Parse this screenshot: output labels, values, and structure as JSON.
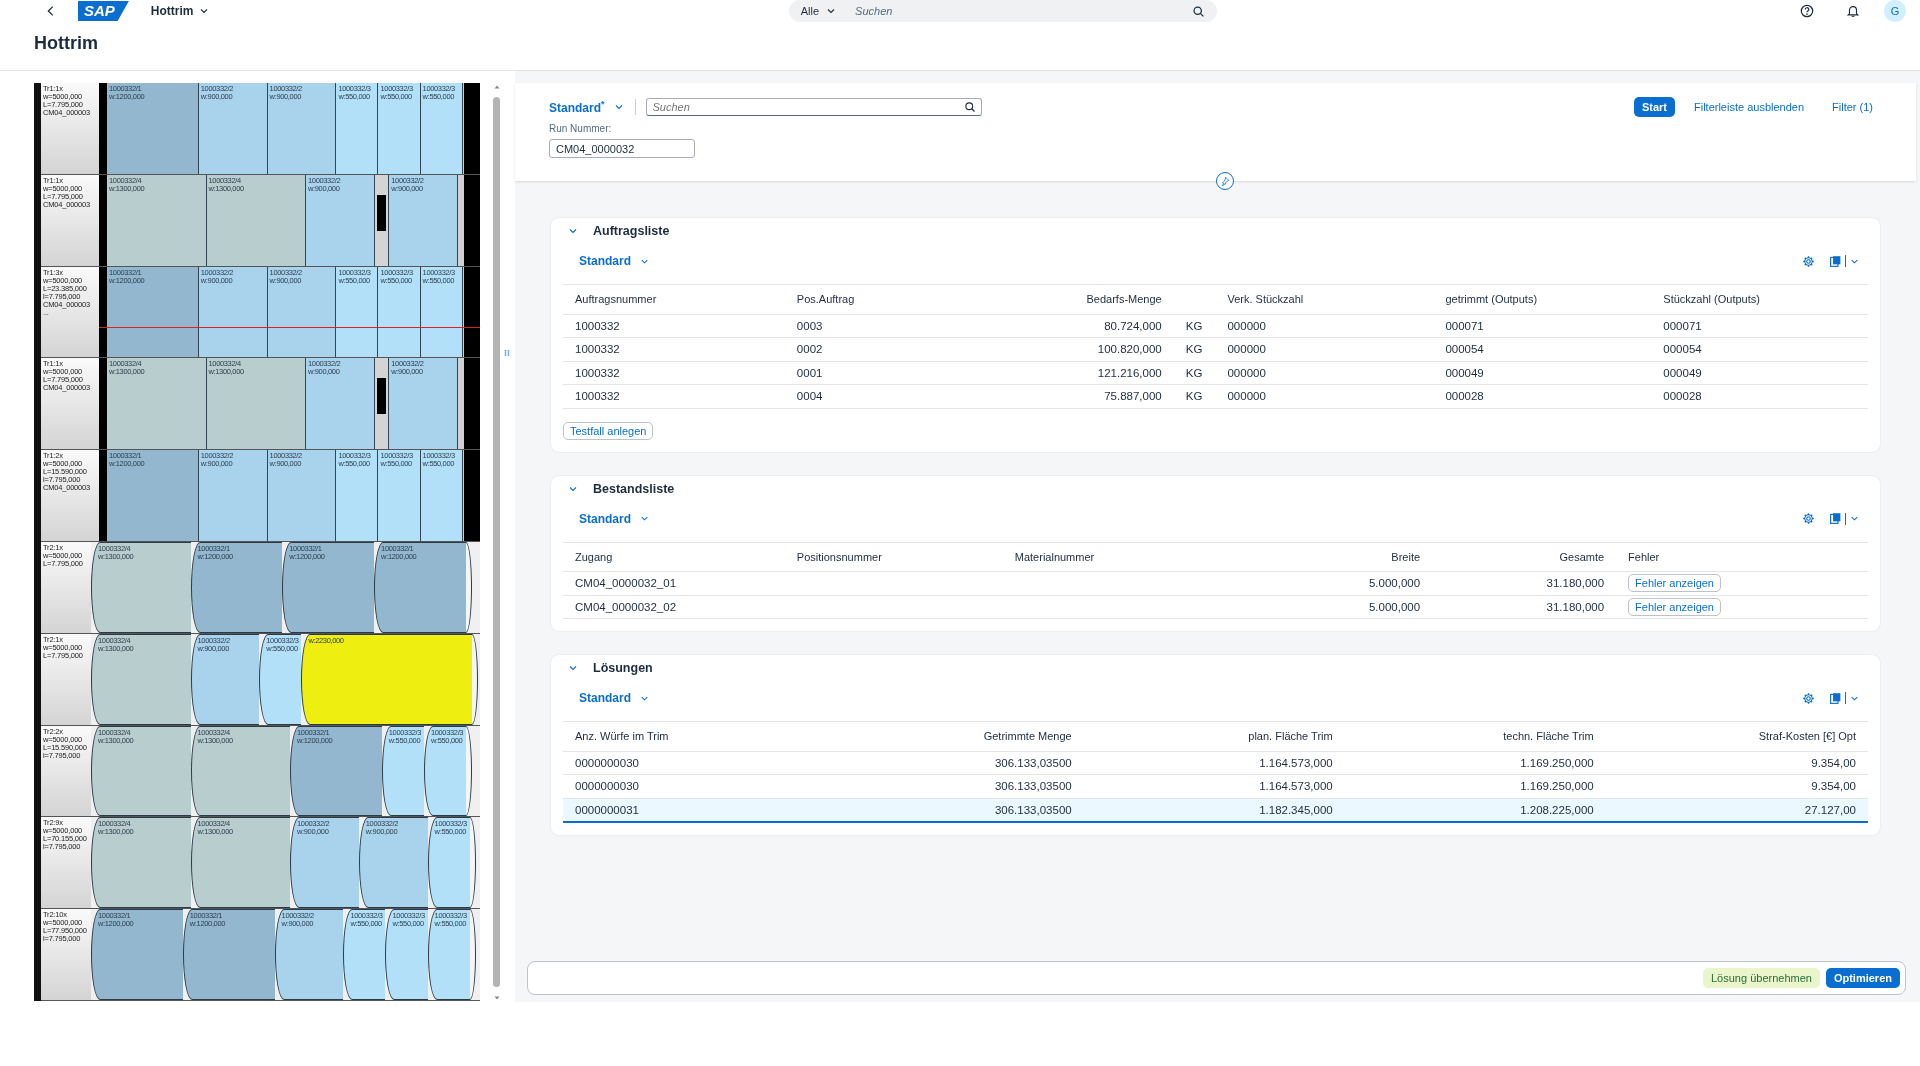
{
  "shell": {
    "logo": "SAP",
    "app_title": "Hottrim",
    "search_scope": "Alle",
    "search_placeholder": "Suchen",
    "avatar": "G"
  },
  "page_title": "Hottrim",
  "diagram": {
    "rows": [
      {
        "kind": "flat",
        "marked": false,
        "label": [
          "Tr1:1x",
          "w=5000,000",
          "L=7.795,000",
          "CM04_000003"
        ],
        "segments": [
          {
            "kind": "p1",
            "id": "1000332/1",
            "width": "w:1200,000"
          },
          {
            "kind": "p2",
            "id": "1000332/2",
            "width": "w:900,000"
          },
          {
            "kind": "p2",
            "id": "1000332/2",
            "width": "w:900,000"
          },
          {
            "kind": "p3",
            "id": "1000332/3",
            "width": "w:550,000"
          },
          {
            "kind": "p3",
            "id": "1000332/3",
            "width": "w:550,000"
          },
          {
            "kind": "p3",
            "id": "1000332/3",
            "width": "w:550,000"
          }
        ]
      },
      {
        "kind": "flat",
        "marked": false,
        "label": [
          "Tr1:1x",
          "w=5000,000",
          "L=7.795,000",
          "CM04_000003"
        ],
        "segments": [
          {
            "kind": "p4",
            "id": "1000332/4",
            "width": "w:1300,000"
          },
          {
            "kind": "p4",
            "id": "1000332/4",
            "width": "w:1300,000"
          },
          {
            "kind": "p2",
            "id": "1000332/2",
            "width": "w:900,000"
          },
          {
            "kind": "gap"
          },
          {
            "kind": "p2",
            "id": "1000332/2",
            "width": "w:900,000"
          }
        ]
      },
      {
        "kind": "flat",
        "marked": true,
        "label": [
          "Tr1:3x",
          "w=5000,000",
          "L=23.385,000",
          "l=7.795,000",
          "CM04_000003",
          "..."
        ],
        "segments": [
          {
            "kind": "p1",
            "id": "1000332/1",
            "width": "w:1200,000"
          },
          {
            "kind": "p2",
            "id": "1000332/2",
            "width": "w:900,000"
          },
          {
            "kind": "p2",
            "id": "1000332/2",
            "width": "w:900,000"
          },
          {
            "kind": "p3",
            "id": "1000332/3",
            "width": "w:550,000"
          },
          {
            "kind": "p3",
            "id": "1000332/3",
            "width": "w:550,000"
          },
          {
            "kind": "p3",
            "id": "1000332/3",
            "width": "w:550,000"
          }
        ]
      },
      {
        "kind": "flat",
        "marked": false,
        "label": [
          "Tr1:1x",
          "w=5000,000",
          "L=7.795,000",
          "CM04_000003"
        ],
        "segments": [
          {
            "kind": "p4",
            "id": "1000332/4",
            "width": "w:1300,000"
          },
          {
            "kind": "p4",
            "id": "1000332/4",
            "width": "w:1300,000"
          },
          {
            "kind": "p2",
            "id": "1000332/2",
            "width": "w:900,000"
          },
          {
            "kind": "gap"
          },
          {
            "kind": "p2",
            "id": "1000332/2",
            "width": "w:900,000"
          }
        ]
      },
      {
        "kind": "flat",
        "marked": false,
        "label": [
          "Tr1:2x",
          "w=5000,000",
          "L=15.590,000",
          "l=7.795,000",
          "CM04_000003"
        ],
        "segments": [
          {
            "kind": "p1",
            "id": "1000332/1",
            "width": "w:1200,000"
          },
          {
            "kind": "p2",
            "id": "1000332/2",
            "width": "w:900,000"
          },
          {
            "kind": "p2",
            "id": "1000332/2",
            "width": "w:900,000"
          },
          {
            "kind": "p3",
            "id": "1000332/3",
            "width": "w:550,000"
          },
          {
            "kind": "p3",
            "id": "1000332/3",
            "width": "w:550,000"
          },
          {
            "kind": "p3",
            "id": "1000332/3",
            "width": "w:550,000"
          }
        ]
      },
      {
        "kind": "roll",
        "marked": false,
        "label": [
          "Tr2:1x",
          "w=5000,000",
          "L=7.795,000"
        ],
        "segments": [
          {
            "kind": "p4",
            "id": "1000332/4",
            "width": "w:1300,000"
          },
          {
            "kind": "p1",
            "id": "1000332/1",
            "width": "w:1200,000"
          },
          {
            "kind": "p1",
            "id": "1000332/1",
            "width": "w:1200,000"
          },
          {
            "kind": "p1",
            "id": "1000332/1",
            "width": "w:1200,000"
          }
        ]
      },
      {
        "kind": "roll",
        "marked": false,
        "label": [
          "Tr2:1x",
          "w=5000,000",
          "L=7.795,000"
        ],
        "segments": [
          {
            "kind": "p4",
            "id": "1000332/4",
            "width": "w:1300,000"
          },
          {
            "kind": "p2",
            "id": "1000332/2",
            "width": "w:900,000"
          },
          {
            "kind": "p3",
            "id": "1000332/3",
            "width": "w:550,000"
          },
          {
            "kind": "rest",
            "width": "w:2230,000"
          }
        ]
      },
      {
        "kind": "roll",
        "marked": false,
        "label": [
          "Tr2:2x",
          "w=5000,000",
          "L=15.590,000",
          "l=7.795,000"
        ],
        "segments": [
          {
            "kind": "p4",
            "id": "1000332/4",
            "width": "w:1300,000"
          },
          {
            "kind": "p4",
            "id": "1000332/4",
            "width": "w:1300,000"
          },
          {
            "kind": "p1",
            "id": "1000332/1",
            "width": "w:1200,000"
          },
          {
            "kind": "p3",
            "id": "1000332/3",
            "width": "w:550,000"
          },
          {
            "kind": "p3",
            "id": "1000332/3",
            "width": "w:550,000"
          }
        ]
      },
      {
        "kind": "roll",
        "marked": false,
        "label": [
          "Tr2:9x",
          "w=5000,000",
          "L=70.155,000",
          "l=7.795,000"
        ],
        "segments": [
          {
            "kind": "p4",
            "id": "1000332/4",
            "width": "w:1300,000"
          },
          {
            "kind": "p4",
            "id": "1000332/4",
            "width": "w:1300,000"
          },
          {
            "kind": "p2",
            "id": "1000332/2",
            "width": "w:900,000"
          },
          {
            "kind": "p2",
            "id": "1000332/2",
            "width": "w:900,000"
          },
          {
            "kind": "p3",
            "id": "1000332/3",
            "width": "w:550,000"
          }
        ]
      },
      {
        "kind": "roll",
        "marked": false,
        "label": [
          "Tr2:10x",
          "w=5000,000",
          "L=77.950,000",
          "l=7.795,000"
        ],
        "segments": [
          {
            "kind": "p1",
            "id": "1000332/1",
            "width": "w:1200,000"
          },
          {
            "kind": "p1",
            "id": "1000332/1",
            "width": "w:1200,000"
          },
          {
            "kind": "p2",
            "id": "1000332/2",
            "width": "w:900,000"
          },
          {
            "kind": "p3",
            "id": "1000332/3",
            "width": "w:550,000"
          },
          {
            "kind": "p3",
            "id": "1000332/3",
            "width": "w:550,000"
          },
          {
            "kind": "p3",
            "id": "1000332/3",
            "width": "w:550,000"
          }
        ]
      }
    ]
  },
  "filter_bar": {
    "variant": "Standard$^{*}$",
    "search_placeholder": "Suchen",
    "filters": [
      {
        "label": "Run Nummer:",
        "value": "CM04_0000032"
      }
    ],
    "buttons": [
      {
        "label": "Start",
        "kind": "emphasized"
      },
      {
        "label": "Filterleiste ausblenden",
        "kind": "transparent"
      },
      {
        "label": "Filter (1)",
        "kind": "transparent"
      }
    ]
  },
  "sections": [
    {
      "title": "Auftragsliste",
      "expanded": true,
      "variant": "Standard",
      "columns": [
        {
          "label": "Auftragsnummer",
          "kind": "text"
        },
        {
          "label": "Pos.Auftrag",
          "kind": "text"
        },
        {
          "label": "Bedarfs-Menge",
          "kind": "number"
        },
        {
          "kind": "text"
        },
        {
          "label": "Verk. Stückzahl",
          "kind": "text"
        },
        {
          "label": "getrimmt (Outputs)",
          "kind": "text"
        },
        {
          "label": "Stückzahl (Outputs)",
          "kind": "text"
        }
      ],
      "rows": [
        {
          "cells": [
            "1000332",
            "0003",
            "80.724,000",
            "KG",
            "000000",
            "000071",
            "000071"
          ]
        },
        {
          "cells": [
            "1000332",
            "0002",
            "100.820,000",
            "KG",
            "000000",
            "000054",
            "000054"
          ]
        },
        {
          "cells": [
            "1000332",
            "0001",
            "121.216,000",
            "KG",
            "000000",
            "000049",
            "000049"
          ]
        },
        {
          "cells": [
            "1000332",
            "0004",
            "75.887,000",
            "KG",
            "000000",
            "000028",
            "000028"
          ]
        }
      ],
      "action": "Testfall anlegen"
    },
    {
      "title": "Bestandsliste",
      "expanded": true,
      "variant": "Standard",
      "columns": [
        {
          "label": "Zugang",
          "kind": "text"
        },
        {
          "label": "Positionsnummer",
          "kind": "text"
        },
        {
          "label": "Materialnummer",
          "kind": "text"
        },
        {
          "label": "Breite",
          "kind": "number"
        },
        {
          "label": "Gesamte",
          "kind": "number"
        },
        {
          "label": "Fehler",
          "kind": "button"
        }
      ],
      "rows": [
        {
          "cells": [
            "CM04_0000032_01",
            "",
            "",
            "5.000,000",
            "31.180,000",
            "Fehler anzeigen"
          ]
        },
        {
          "cells": [
            "CM04_0000032_02",
            "",
            "",
            "5.000,000",
            "31.180,000",
            "Fehler anzeigen"
          ]
        }
      ]
    },
    {
      "title": "Lösungen",
      "expanded": true,
      "variant": "Standard",
      "columns": [
        {
          "label": "Anz. Würfe im Trim",
          "kind": "text"
        },
        {
          "label": "Getrimmte Menge",
          "kind": "number"
        },
        {
          "label": "plan. Fläche Trim",
          "kind": "number"
        },
        {
          "label": "techn. Fläche Trim",
          "kind": "number"
        },
        {
          "label": "Straf-Kosten [€] Opt",
          "kind": "number"
        }
      ],
      "rows": [
        {
          "selected": false,
          "cells": [
            "0000000030",
            "306.133,03500",
            "1.164.573,000",
            "1.169.250,000",
            "9.354,00"
          ]
        },
        {
          "selected": false,
          "cells": [
            "0000000030",
            "306.133,03500",
            "1.164.573,000",
            "1.169.250,000",
            "9.354,00"
          ]
        },
        {
          "selected": true,
          "cells": [
            "0000000031",
            "306.133,03500",
            "1.182.345,000",
            "1.208.225,000",
            "27.127,00"
          ]
        }
      ]
    }
  ],
  "footer": {
    "buttons": [
      {
        "label": "Lösung übernehmen",
        "kind": "accept"
      },
      {
        "label": "Optimieren",
        "kind": "emphasized"
      }
    ]
  }
}
